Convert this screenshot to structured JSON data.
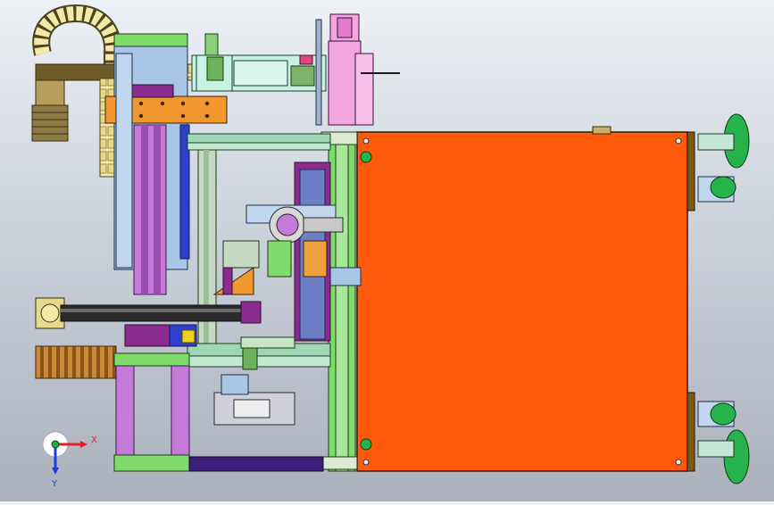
{
  "view": {
    "background_top": "#eef1f5",
    "background_bottom": "#aab1bb",
    "triad": {
      "x_label": "X",
      "y_label": "Y",
      "x_color": "#e0202a",
      "y_color": "#1c3fd6",
      "z_color": "#17b33a"
    }
  },
  "model": {
    "main_plate_color": "#ff5a0c",
    "cylinder_color": "#f3a6e0",
    "carriage_color": "#a9c6e6",
    "purple_column_color": "#c47ad8",
    "orange_bracket_color": "#f0982e",
    "frame_green_color": "#7fdc6a",
    "drag_chain_color": "#f4e9a8",
    "wheel_color": "#27b34c",
    "blue_post_color": "#2e3fcc",
    "magenta_block_color": "#8a2b8e"
  }
}
